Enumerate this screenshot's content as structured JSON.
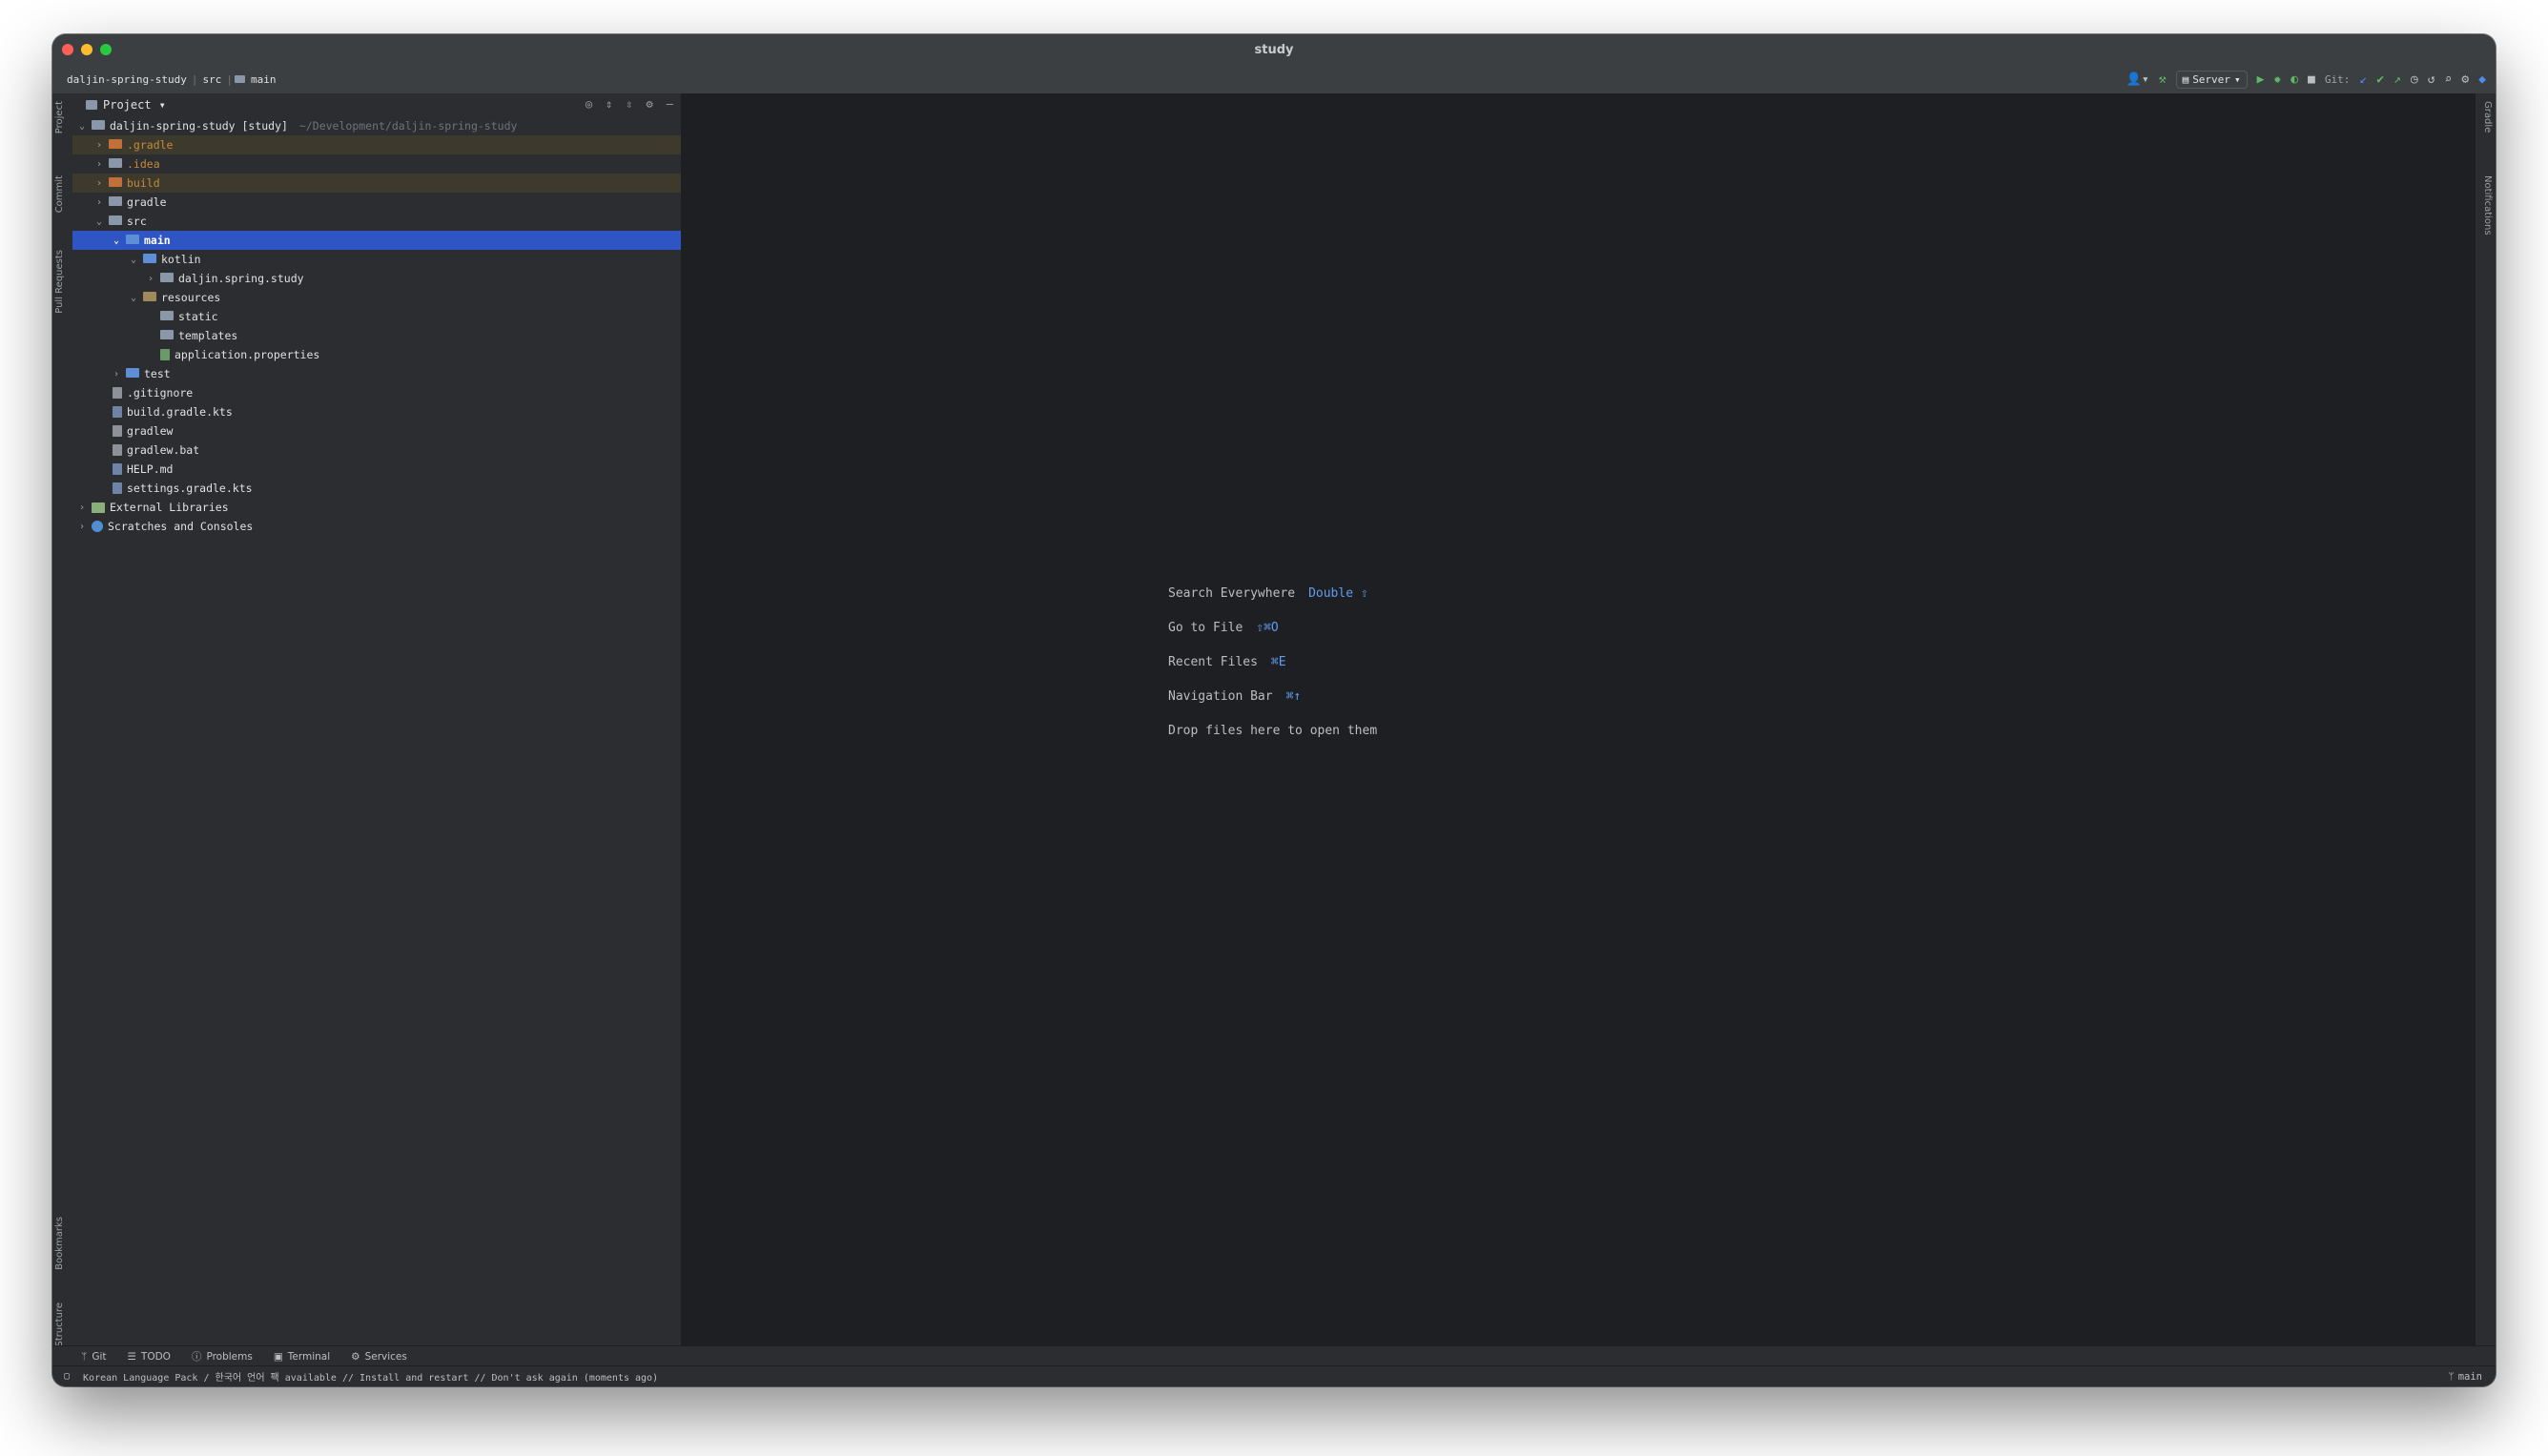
{
  "window": {
    "title": "study"
  },
  "breadcrumb": [
    "daljin-spring-study",
    "src",
    "main"
  ],
  "toolbar": {
    "run_config": "Server",
    "git_label": "Git:"
  },
  "left_tool_tabs": [
    "Project",
    "Commit",
    "Pull Requests",
    "Bookmarks",
    "Structure"
  ],
  "right_tool_tabs": [
    "Gradle",
    "Notifications"
  ],
  "project_panel": {
    "title": "Project",
    "root": {
      "name": "daljin-spring-study [study]",
      "path": "~/Development/daljin-spring-study"
    },
    "items": [
      ".gradle",
      ".idea",
      "build",
      "gradle",
      "src",
      "main",
      "kotlin",
      "daljin.spring.study",
      "resources",
      "static",
      "templates",
      "application.properties",
      "test",
      ".gitignore",
      "build.gradle.kts",
      "gradlew",
      "gradlew.bat",
      "HELP.md",
      "settings.gradle.kts",
      "External Libraries",
      "Scratches and Consoles"
    ]
  },
  "editor_hints": [
    {
      "label": "Search Everywhere",
      "shortcut": "Double ⇧"
    },
    {
      "label": "Go to File",
      "shortcut": "⇧⌘O"
    },
    {
      "label": "Recent Files",
      "shortcut": "⌘E"
    },
    {
      "label": "Navigation Bar",
      "shortcut": "⌘↑"
    },
    {
      "label": "Drop files here to open them",
      "shortcut": ""
    }
  ],
  "bottom_tools": [
    "Git",
    "TODO",
    "Problems",
    "Terminal",
    "Services"
  ],
  "status": {
    "message": "Korean Language Pack / 한국어 언어 팩 available // Install and restart // Don't ask again (moments ago)",
    "branch": "main"
  },
  "colors": {
    "selection": "#2f54c4",
    "excluded_row": "#3d3a2d",
    "editor_bg": "#1e1f22",
    "panel_bg": "#2b2d30",
    "accent_blue": "#5f9cf0"
  }
}
